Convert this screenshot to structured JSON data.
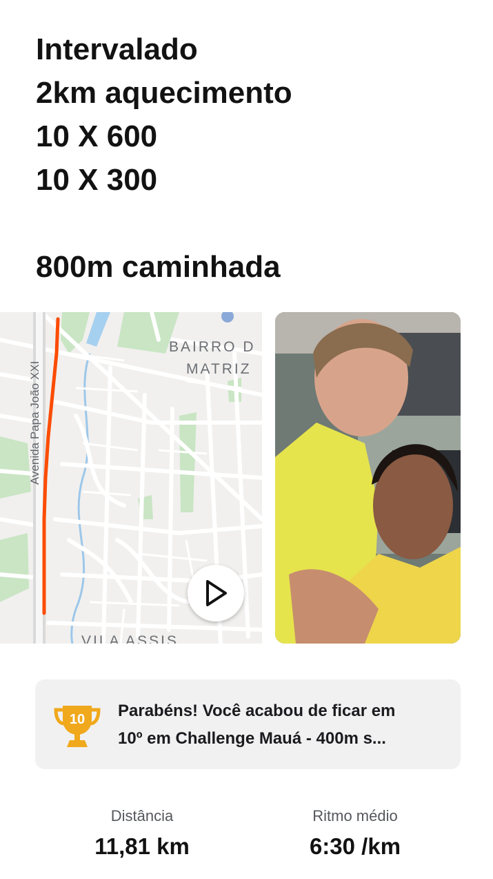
{
  "activity": {
    "description_lines": [
      "Intervalado",
      "2km aquecimento",
      "10 X 600",
      "10 X 300",
      "",
      "800m caminhada"
    ]
  },
  "map": {
    "labels": {
      "street": "Avenida Papa João XXI",
      "neighborhood_1": "BAIRRO D",
      "neighborhood_1b": "MATRIZ",
      "neighborhood_2": "VILA ASSIS"
    },
    "route_color": "#fc4c02",
    "play_icon": "play-icon"
  },
  "photo": {
    "icon": "selfie-photo"
  },
  "achievement": {
    "icon": "trophy-icon",
    "badge": "10",
    "line1": "Parabéns! Você acabou de ficar em",
    "line2": "10º em Challenge Mauá - 400m s..."
  },
  "stats": [
    {
      "label": "Distância",
      "value": "11,81 km"
    },
    {
      "label": "Ritmo médio",
      "value": "6:30 /km"
    }
  ],
  "colors": {
    "trophy": "#f0a81c",
    "card_bg": "#f1f1f1",
    "route": "#fc4c02"
  }
}
